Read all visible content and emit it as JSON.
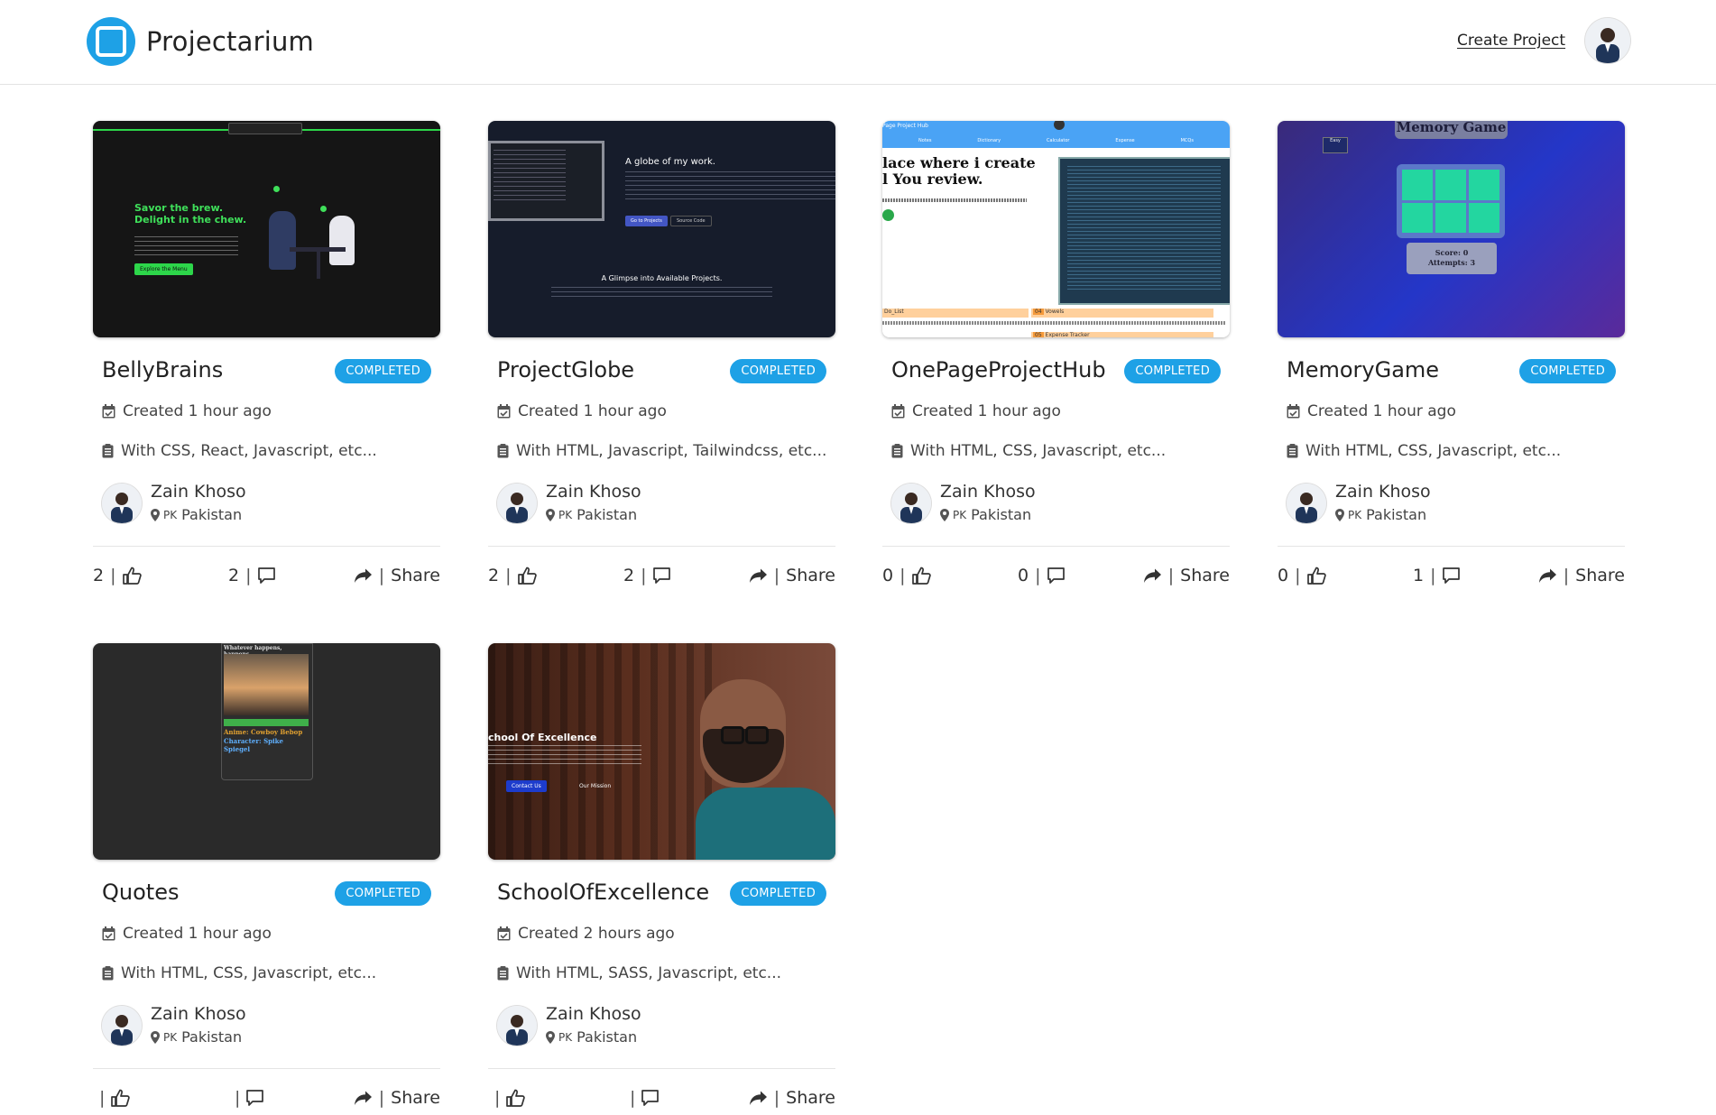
{
  "header": {
    "app_title": "Projectarium",
    "create_project_label": "Create Project"
  },
  "projects": [
    {
      "title": "BellyBrains",
      "status": "COMPLETED",
      "created": "Created 1 hour ago",
      "stack": "With CSS, React, Javascript, etc...",
      "author": "Zain Khoso",
      "country_code": "PK",
      "country": "Pakistan",
      "likes": "2",
      "comments": "2",
      "share_label": "Share",
      "thumb_text": {
        "headline": "Savor the brew.",
        "headline2": "Delight in the chew.",
        "cta": "Explore the Menu"
      }
    },
    {
      "title": "ProjectGlobe",
      "status": "COMPLETED",
      "created": "Created 1 hour ago",
      "stack": "With HTML, Javascript, Tailwindcss, etc...",
      "author": "Zain Khoso",
      "country_code": "PK",
      "country": "Pakistan",
      "likes": "2",
      "comments": "2",
      "share_label": "Share",
      "thumb_text": {
        "headline": "A globe of my work.",
        "sub": "A Glimpse into Available Projects.",
        "btn1": "Go to Projects",
        "btn2": "Source Code"
      }
    },
    {
      "title": "OnePageProjectHub",
      "status": "COMPLETED",
      "created": "Created 1 hour ago",
      "stack": "With HTML, CSS, Javascript, etc...",
      "author": "Zain Khoso",
      "country_code": "PK",
      "country": "Pakistan",
      "likes": "0",
      "comments": "0",
      "share_label": "Share",
      "thumb_text": {
        "headline": "lace where i create",
        "headline2": "l You review.",
        "item1": "Do_List",
        "item2": "Vowels",
        "item3": "Expense Tracker",
        "num2": "04",
        "num3": "05",
        "nav": [
          "Notes",
          "Dictionary",
          "Calculator",
          "Expense",
          "MCQs"
        ]
      }
    },
    {
      "title": "MemoryGame",
      "status": "COMPLETED",
      "created": "Created 1 hour ago",
      "stack": "With HTML, CSS, Javascript, etc...",
      "author": "Zain Khoso",
      "country_code": "PK",
      "country": "Pakistan",
      "likes": "0",
      "comments": "1",
      "share_label": "Share",
      "thumb_text": {
        "headline": "Memory Game",
        "score": "Score: 0",
        "attempts": "Attempts: 3",
        "level": "Easy"
      }
    },
    {
      "title": "Quotes",
      "status": "COMPLETED",
      "created": "Created 1 hour ago",
      "stack": "With HTML, CSS, Javascript, etc...",
      "author": "Zain Khoso",
      "country_code": "PK",
      "country": "Pakistan",
      "likes": "",
      "comments": "",
      "share_label": "Share",
      "thumb_text": {
        "headline": "Whatever happens, happens.",
        "anime": "Anime: Cowboy Bebop",
        "character": "Character: Spike Spiegel"
      }
    },
    {
      "title": "SchoolOfExcellence",
      "status": "COMPLETED",
      "created": "Created 2 hours ago",
      "stack": "With HTML, SASS, Javascript, etc...",
      "author": "Zain Khoso",
      "country_code": "PK",
      "country": "Pakistan",
      "likes": "",
      "comments": "",
      "share_label": "Share",
      "thumb_text": {
        "headline": "chool Of Excellence",
        "btn1": "Contact Us",
        "btn2": "Our Mission"
      }
    }
  ],
  "colors": {
    "accent": "#1ea1e6",
    "text": "#222222"
  }
}
